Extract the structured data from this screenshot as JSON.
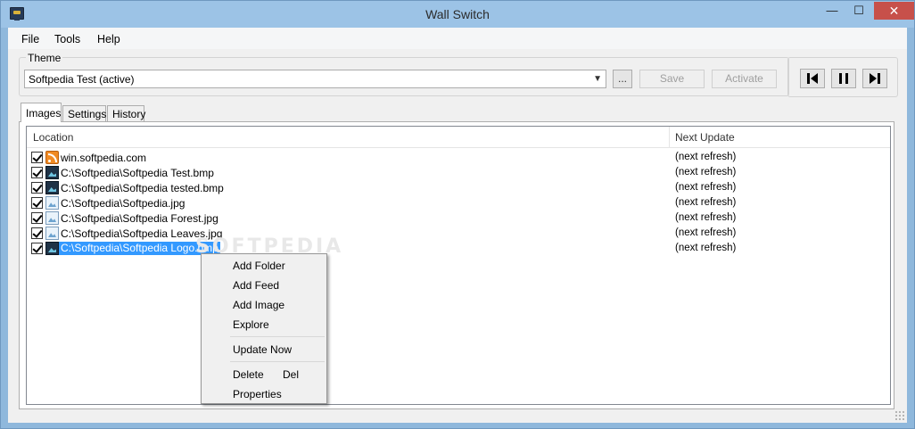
{
  "window": {
    "title": "Wall Switch",
    "minimize_glyph": "—",
    "maximize_glyph": "☐",
    "close_glyph": "✕"
  },
  "menu": [
    "File",
    "Tools",
    "Help"
  ],
  "theme": {
    "legend": "Theme",
    "selected": "Softpedia Test (active)",
    "browse_label": "...",
    "save_label": "Save",
    "activate_label": "Activate"
  },
  "tabs": [
    "Images",
    "Settings",
    "History"
  ],
  "list": {
    "col_location": "Location",
    "col_next_update": "Next Update",
    "rows": [
      {
        "location": "win.softpedia.com",
        "next": "(next refresh)",
        "icon": "feed-icon"
      },
      {
        "location": "C:\\Softpedia\\Softpedia Test.bmp",
        "next": "(next refresh)",
        "icon": "bmp-image-icon"
      },
      {
        "location": "C:\\Softpedia\\Softpedia tested.bmp",
        "next": "(next refresh)",
        "icon": "bmp-image-icon"
      },
      {
        "location": "C:\\Softpedia\\Softpedia.jpg",
        "next": "(next refresh)",
        "icon": "jpg-image-icon"
      },
      {
        "location": "C:\\Softpedia\\Softpedia Forest.jpg",
        "next": "(next refresh)",
        "icon": "jpg-image-icon"
      },
      {
        "location": "C:\\Softpedia\\Softpedia Leaves.jpg",
        "next": "(next refresh)",
        "icon": "jpg-image-icon"
      },
      {
        "location": "C:\\Softpedia\\Softpedia Logo.bmp",
        "next": "(next refresh)",
        "icon": "bmp-image-icon"
      }
    ]
  },
  "context_menu": {
    "add_folder": "Add Folder",
    "add_feed": "Add Feed",
    "add_image": "Add Image",
    "explore": "Explore",
    "update_now": "Update Now",
    "delete": "Delete",
    "delete_shortcut": "Del",
    "properties": "Properties"
  },
  "watermark": "SOFTPEDIA"
}
